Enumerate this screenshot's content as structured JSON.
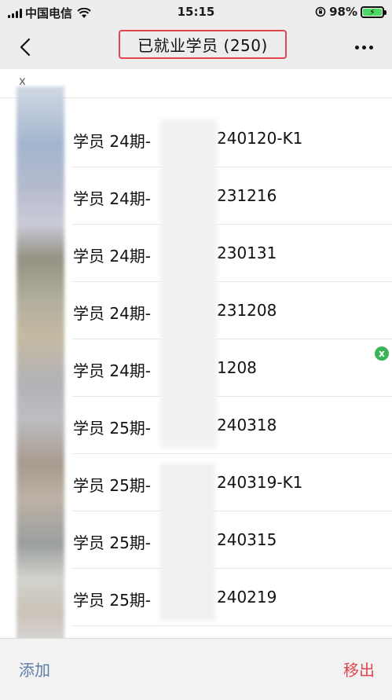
{
  "status_bar": {
    "carrier": "中国电信",
    "time": "15:15",
    "battery": "98%"
  },
  "nav": {
    "title": "已就业学员 (250)"
  },
  "search": {
    "clear_label": "x"
  },
  "members": [
    {
      "prefix": "学员 24期-",
      "suffix": "240120-K1"
    },
    {
      "prefix": "学员 24期-",
      "suffix": "231216"
    },
    {
      "prefix": "学员 24期-",
      "suffix": "230131"
    },
    {
      "prefix": "学员 24期-",
      "suffix": "231208"
    },
    {
      "prefix": "学员 24期-",
      "suffix": "1208"
    },
    {
      "prefix": "学员 25期-",
      "suffix": "240318"
    },
    {
      "prefix": "学员 25期-",
      "suffix": "240319-K1"
    },
    {
      "prefix": "学员 25期-",
      "suffix": "240315"
    },
    {
      "prefix": "学员 25期-",
      "suffix": "240219"
    }
  ],
  "badge": "x",
  "bottom_bar": {
    "add_label": "添加",
    "remove_label": "移出"
  },
  "colors": {
    "highlight_border": "#e0464c",
    "add": "#5e7ca8",
    "remove": "#e0464c",
    "badge": "#3db35b"
  }
}
